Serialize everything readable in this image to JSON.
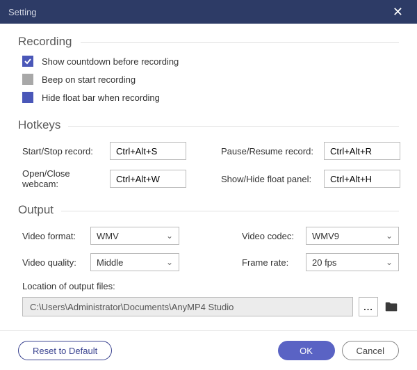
{
  "title": "Setting",
  "recording": {
    "heading": "Recording",
    "opt1": "Show countdown before recording",
    "opt2": "Beep on start recording",
    "opt3": "Hide float bar when recording"
  },
  "hotkeys": {
    "heading": "Hotkeys",
    "start_label": "Start/Stop record:",
    "start_val": "Ctrl+Alt+S",
    "pause_label": "Pause/Resume record:",
    "pause_val": "Ctrl+Alt+R",
    "webcam_label": "Open/Close webcam:",
    "webcam_val": "Ctrl+Alt+W",
    "float_label": "Show/Hide float panel:",
    "float_val": "Ctrl+Alt+H"
  },
  "output": {
    "heading": "Output",
    "vformat_label": "Video format:",
    "vformat_val": "WMV",
    "vcodec_label": "Video codec:",
    "vcodec_val": "WMV9",
    "vquality_label": "Video quality:",
    "vquality_val": "Middle",
    "fps_label": "Frame rate:",
    "fps_val": "20 fps",
    "loc_label": "Location of output files:",
    "loc_val": "C:\\Users\\Administrator\\Documents\\AnyMP4 Studio",
    "browse": "..."
  },
  "footer": {
    "reset": "Reset to Default",
    "ok": "OK",
    "cancel": "Cancel"
  }
}
